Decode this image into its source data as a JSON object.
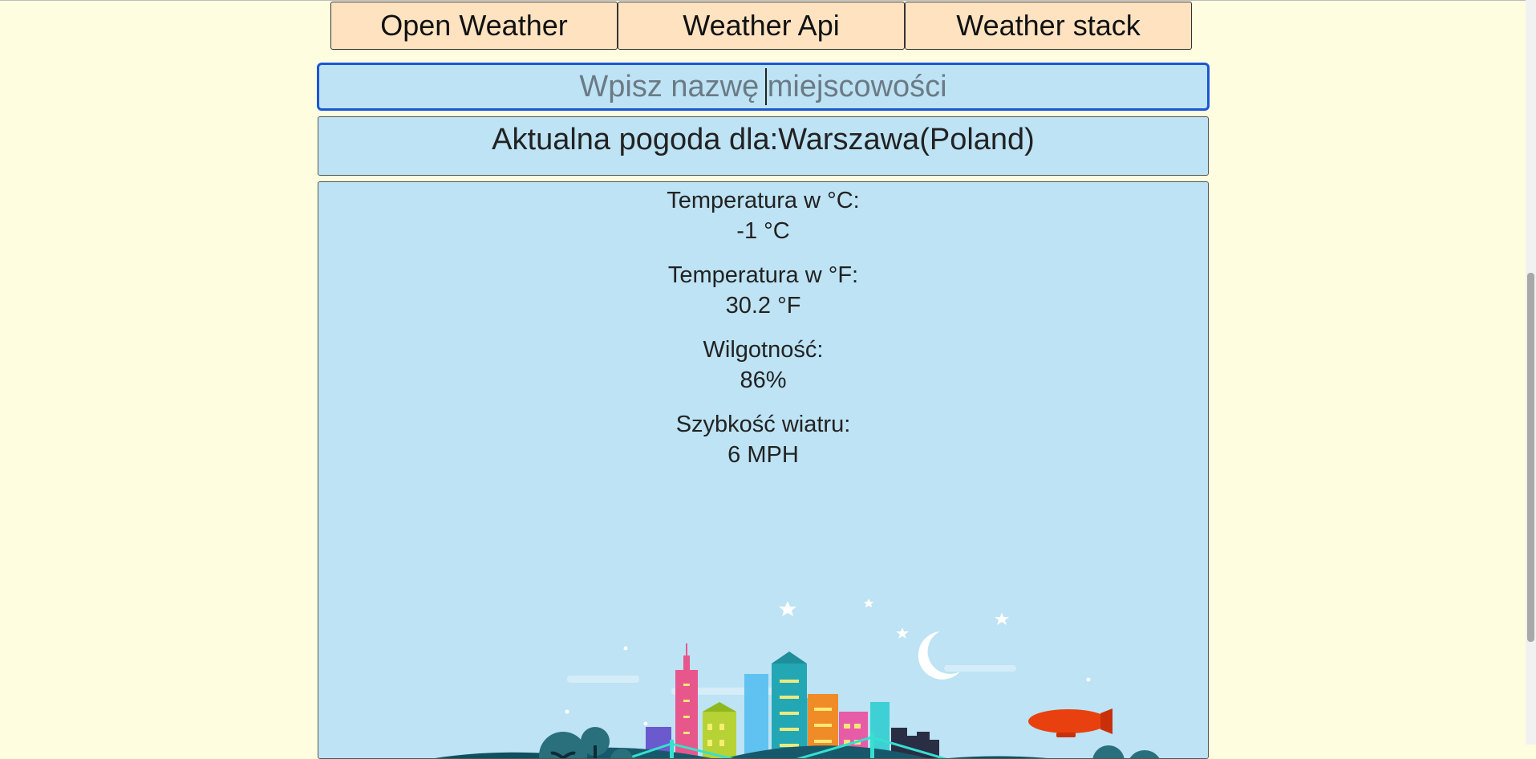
{
  "tabs": [
    {
      "label": "Open Weather"
    },
    {
      "label": "Weather Api"
    },
    {
      "label": "Weather stack"
    }
  ],
  "search": {
    "placeholder": "Wpisz nazwę miejscowości"
  },
  "location": {
    "title": "Aktualna pogoda dla:Warszawa(Poland)"
  },
  "stats": [
    {
      "label": "Temperatura w °C:",
      "value": "-1 °C"
    },
    {
      "label": "Temperatura w °F:",
      "value": "30.2 °F"
    },
    {
      "label": "Wilgotność:",
      "value": "86%"
    },
    {
      "label": "Szybkość wiatru:",
      "value": "6 MPH"
    }
  ],
  "colors": {
    "page_bg": "#fffde0",
    "tab_bg": "#ffe3c1",
    "panel_bg": "#bde3f4",
    "focus_border": "#1a56d6"
  },
  "illustration": {
    "icon": "city-night-skyline-illustration"
  }
}
